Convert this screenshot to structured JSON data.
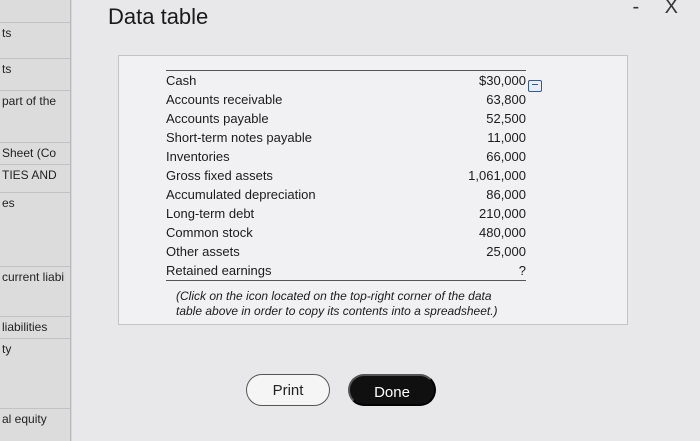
{
  "background_panel": {
    "items": [
      "ts",
      "ts",
      "part of the",
      "Sheet (Co",
      "TIES AND",
      "es",
      "current liabi",
      "liabilities",
      "ty",
      "al equity"
    ]
  },
  "modal": {
    "title": "Data table",
    "window_controls": "- X",
    "rows": [
      {
        "label": "Cash",
        "value": "$30,000"
      },
      {
        "label": "Accounts receivable",
        "value": "63,800"
      },
      {
        "label": "Accounts payable",
        "value": "52,500"
      },
      {
        "label": "Short-term notes payable",
        "value": "11,000"
      },
      {
        "label": "Inventories",
        "value": "66,000"
      },
      {
        "label": "Gross fixed assets",
        "value": "1,061,000"
      },
      {
        "label": "Accumulated depreciation",
        "value": "86,000"
      },
      {
        "label": "Long-term debt",
        "value": "210,000"
      },
      {
        "label": "Common stock",
        "value": "480,000"
      },
      {
        "label": "Other assets",
        "value": "25,000"
      },
      {
        "label": "Retained earnings",
        "value": "?"
      }
    ],
    "note": "(Click on the icon located on the top-right corner of the data table above in order to copy its contents into a spreadsheet.)",
    "print_label": "Print",
    "done_label": "Done",
    "icons": {
      "copy": "copy-spreadsheet-icon"
    }
  }
}
